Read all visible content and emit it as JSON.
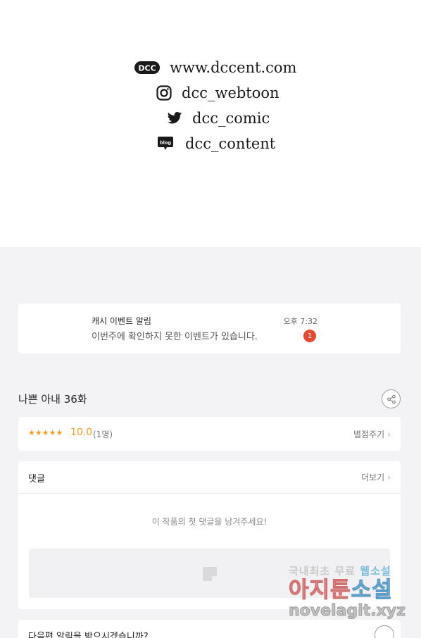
{
  "social": {
    "website": "www.dccent.com",
    "instagram": "dcc_webtoon",
    "twitter": "dcc_comic",
    "blog": "dcc_content",
    "logo_text": "DCC",
    "blog_icon_text": "blog"
  },
  "notification": {
    "title": "캐시 이벤트 알림",
    "body": "이번주에 확인하지 못한 이벤트가 있습니다.",
    "time": "오후 7:32",
    "badge": "1"
  },
  "episode": {
    "title": "나쁜 아내 36화"
  },
  "rating": {
    "stars": "★★★★★",
    "score": "10.0",
    "count": "(1명)",
    "rate_label": "별점주기"
  },
  "comments": {
    "header": "댓글",
    "more_label": "더보기",
    "empty_message": "이 작품의 첫 댓글을 남겨주세요!"
  },
  "subscribe": {
    "text": "다음편 알림을 받으시겠습니까?"
  },
  "watermark": {
    "line1": "국내최초 무료",
    "line1_accent": "웹소설",
    "line2": "아지툰",
    "line2_accent": "소설",
    "line3": "novelagit.xyz"
  },
  "colors": {
    "accent_star": "#f0a020",
    "badge": "#e8492f",
    "page_bg": "#f3f3f5"
  }
}
